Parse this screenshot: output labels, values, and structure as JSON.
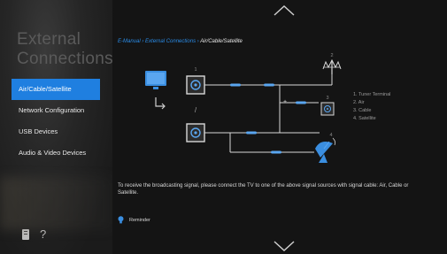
{
  "sidebar": {
    "title_line1": "External",
    "title_line2": "Connections",
    "items": [
      {
        "label": "Air/Cable/Satellite",
        "selected": true
      },
      {
        "label": "Network Configuration",
        "selected": false
      },
      {
        "label": "USB Devices",
        "selected": false
      },
      {
        "label": "Audio & Video Devices",
        "selected": false
      }
    ],
    "bottom_icons": [
      "book-icon",
      "help-icon"
    ],
    "help_glyph": "?"
  },
  "breadcrumb": {
    "items": [
      "E-Manual",
      "External Connections",
      "Air/Cable/Satellite"
    ],
    "separator": "›"
  },
  "diagram": {
    "numbers": [
      "1",
      "2",
      "3",
      "4"
    ],
    "or_glyph": "/",
    "legend": [
      "1. Tuner Terminal",
      "2. Air",
      "3. Cable",
      "4. Satellite"
    ]
  },
  "description": "To receive the broadcasting signal, please connect the TV to one of the above signal sources with signal cable: Air, Cable or Satellite.",
  "reminder_label": "Reminder",
  "colors": {
    "accent": "#1f7fe0",
    "link": "#2a8be6"
  }
}
